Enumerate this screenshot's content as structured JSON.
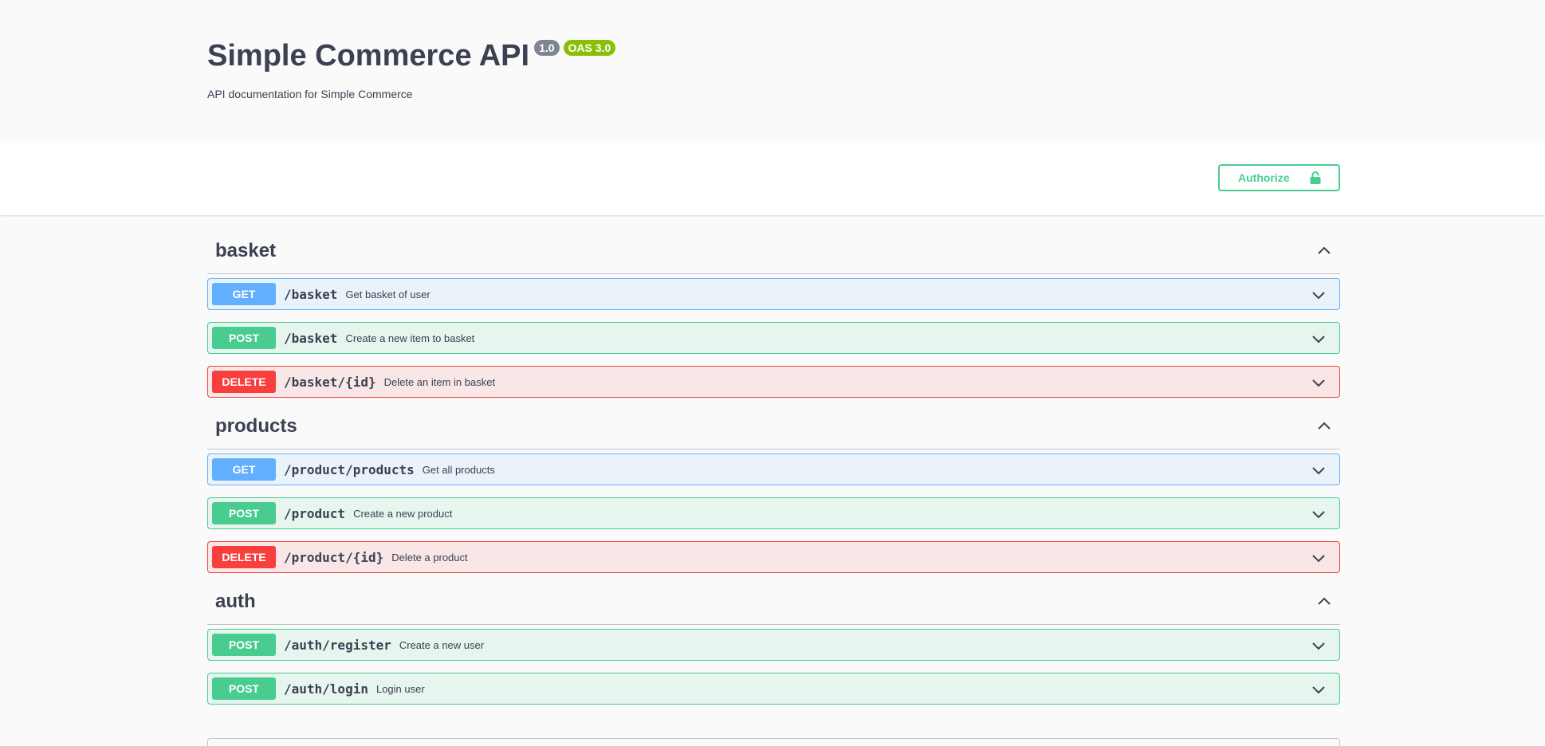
{
  "info": {
    "title": "Simple Commerce API",
    "version": "1.0",
    "oas": "OAS 3.0",
    "description": "API documentation for Simple Commerce"
  },
  "scheme": {
    "authorize_label": "Authorize"
  },
  "colors": {
    "get": "#61affe",
    "post": "#49cc90",
    "delete": "#f93e3e",
    "text": "#3b4151"
  },
  "tags": [
    {
      "name": "basket",
      "operations": [
        {
          "method": "GET",
          "path": "/basket",
          "summary": "Get basket of user"
        },
        {
          "method": "POST",
          "path": "/basket",
          "summary": "Create a new item to basket"
        },
        {
          "method": "DELETE",
          "path": "/basket/{id}",
          "summary": "Delete an item in basket"
        }
      ]
    },
    {
      "name": "products",
      "operations": [
        {
          "method": "GET",
          "path": "/product/products",
          "summary": "Get all products"
        },
        {
          "method": "POST",
          "path": "/product",
          "summary": "Create a new product"
        },
        {
          "method": "DELETE",
          "path": "/product/{id}",
          "summary": "Delete a product"
        }
      ]
    },
    {
      "name": "auth",
      "operations": [
        {
          "method": "POST",
          "path": "/auth/register",
          "summary": "Create a new user"
        },
        {
          "method": "POST",
          "path": "/auth/login",
          "summary": "Login user"
        }
      ]
    }
  ]
}
